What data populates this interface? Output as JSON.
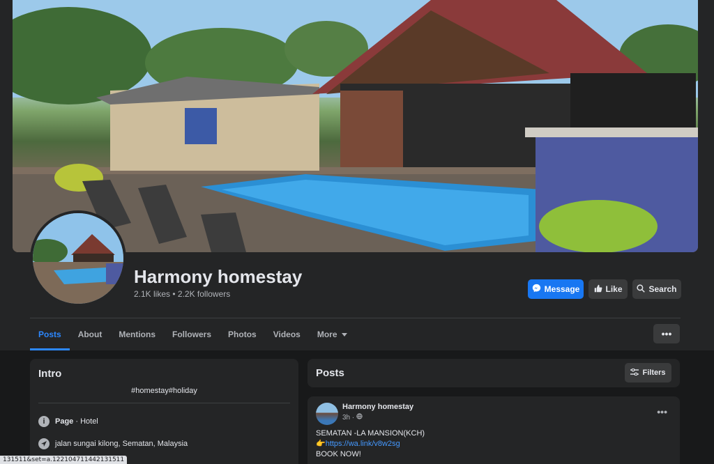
{
  "page": {
    "name": "Harmony homestay",
    "stats": "2.1K likes • 2.2K followers"
  },
  "actions": {
    "message": "Message",
    "like": "Like",
    "search": "Search"
  },
  "tabs": [
    {
      "label": "Posts",
      "active": true
    },
    {
      "label": "About"
    },
    {
      "label": "Mentions"
    },
    {
      "label": "Followers"
    },
    {
      "label": "Photos"
    },
    {
      "label": "Videos"
    },
    {
      "label": "More"
    }
  ],
  "more_menu_glyph": "•••",
  "intro": {
    "title": "Intro",
    "tags": "#homestay#holiday",
    "category_label": "Page",
    "category_value": " · Hotel",
    "address": "jalan sungai kilong, Sematan, Malaysia"
  },
  "posts_section": {
    "title": "Posts",
    "filters": "Filters"
  },
  "post": {
    "author": "Harmony homestay",
    "time": "3h ·",
    "line1": "SEMATAN -LA MANSION(KCH)",
    "link": "https://wa.link/v8w2sg",
    "link_emoji": "👉",
    "line3": "BOOK NOW!"
  },
  "status_bar": {
    "url": "131511&set=a.122104711442131511"
  },
  "colors": {
    "accent": "#1877f2",
    "active_tab": "#2d88ff",
    "background": "#18191a",
    "card": "#242526"
  },
  "icons": [
    "messenger-icon",
    "thumbs-up-icon",
    "search-icon",
    "chevron-down-icon",
    "filters-icon",
    "info-icon",
    "location-icon",
    "globe-icon",
    "more-icon"
  ]
}
